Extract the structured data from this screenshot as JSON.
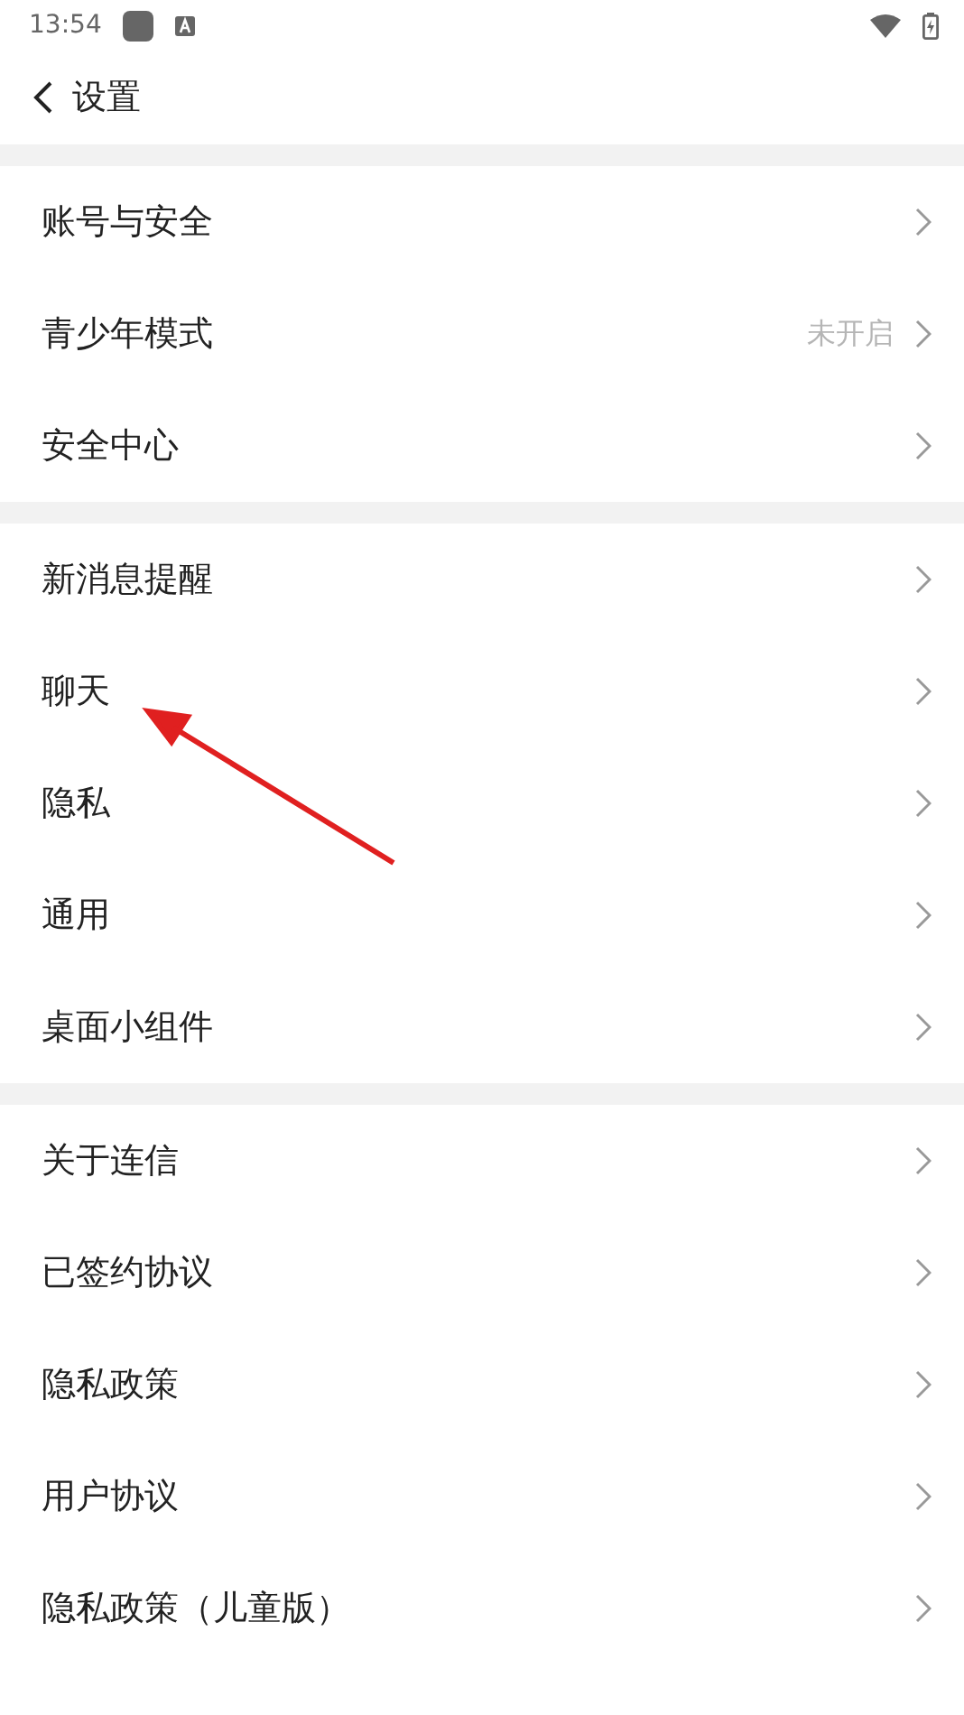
{
  "status_bar": {
    "time": "13:54"
  },
  "header": {
    "title": "设置"
  },
  "groups": [
    {
      "items": [
        {
          "label": "账号与安全"
        },
        {
          "label": "青少年模式",
          "value": "未开启"
        },
        {
          "label": "安全中心"
        }
      ]
    },
    {
      "items": [
        {
          "label": "新消息提醒"
        },
        {
          "label": "聊天"
        },
        {
          "label": "隐私"
        },
        {
          "label": "通用"
        },
        {
          "label": "桌面小组件"
        }
      ]
    },
    {
      "items": [
        {
          "label": "关于连信"
        },
        {
          "label": "已签约协议"
        },
        {
          "label": "隐私政策"
        },
        {
          "label": "用户协议"
        },
        {
          "label": "隐私政策（儿童版）"
        }
      ]
    }
  ]
}
